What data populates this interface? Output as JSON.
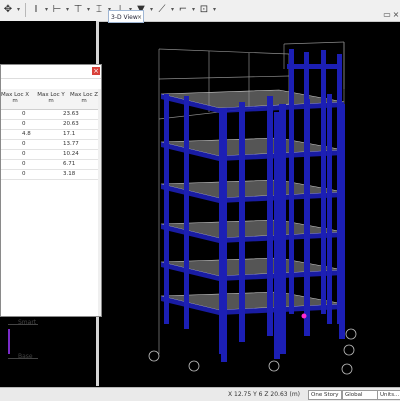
{
  "app": {
    "view_tab_title": "3-D View",
    "tab_close_glyph": "×"
  },
  "toolbar": {
    "items": [
      {
        "icon": "pan-icon",
        "glyph": "✥"
      },
      {
        "icon": "text-cursor-icon",
        "glyph": "I"
      },
      {
        "icon": "line-tool-icon",
        "glyph": "⊢"
      },
      {
        "icon": "snap-icon",
        "glyph": "⊤"
      },
      {
        "icon": "section-cut-icon",
        "glyph": "⌶"
      },
      {
        "icon": "grid-tool-icon",
        "glyph": "⊥"
      },
      {
        "icon": "filter-icon",
        "glyph": "▼"
      },
      {
        "icon": "draw-line-icon",
        "glyph": "⟋"
      },
      {
        "icon": "select-icon",
        "glyph": "⌐"
      },
      {
        "icon": "assign-icon",
        "glyph": "⊡"
      }
    ],
    "dropdown_glyph": "▾"
  },
  "table": {
    "columns": [
      {
        "label": "Max Loc X",
        "unit": "m"
      },
      {
        "label": "Max Loc Y",
        "unit": "m"
      },
      {
        "label": "Max Loc Z",
        "unit": "m"
      }
    ],
    "rows": [
      {
        "y": "0",
        "z": "23.63"
      },
      {
        "y": "0",
        "z": "20.63"
      },
      {
        "y": "4.8",
        "z": "17.1"
      },
      {
        "y": "0",
        "z": "13.77"
      },
      {
        "y": "0",
        "z": "10.24"
      },
      {
        "y": "0",
        "z": "6.71"
      },
      {
        "y": "0",
        "z": "3.18"
      }
    ]
  },
  "legend": {
    "top_label": "Smart",
    "bottom_label": "Base"
  },
  "status": {
    "coords": "X 12.75  Y 6  Z 20.63 (m)",
    "story_select": "One Story",
    "coord_system": "Global",
    "units": "Units..."
  },
  "colors": {
    "column": "#1c1fb5",
    "slab": "#9a9a9a",
    "grid": "#8c8c8c",
    "background": "#000000",
    "support": "#ff2bd0"
  }
}
